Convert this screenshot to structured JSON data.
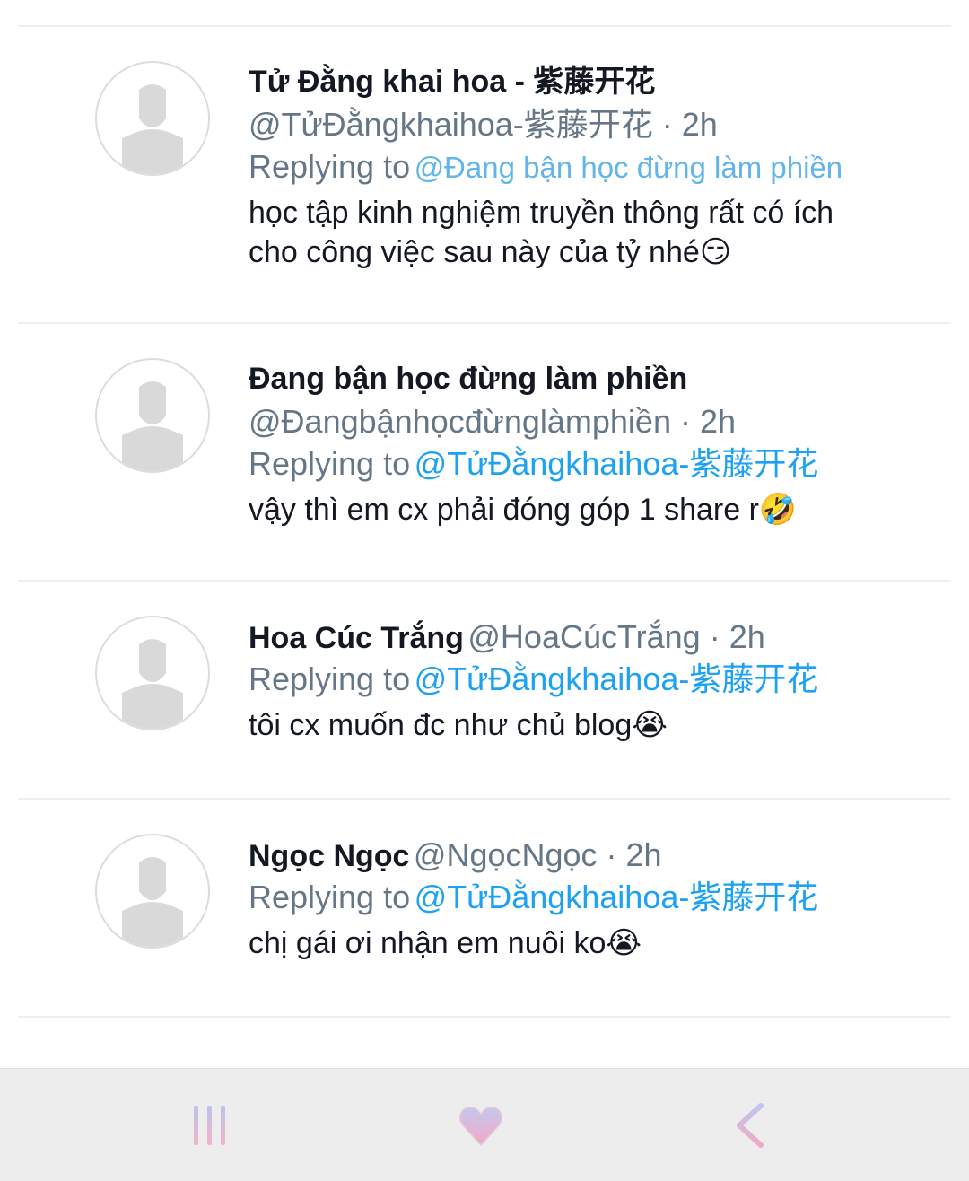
{
  "replies": [
    {
      "name": "Tử Đằng khai hoa - 紫藤开花",
      "handle": "@TửĐằngkhaihoa-紫藤开花 · 2h",
      "replying_label": "Replying to",
      "replying_to": "@Đang bận học đừng làm phiền",
      "text_lines": [
        "học tập kinh nghiệm truyền thông rất có ích",
        "cho công việc sau này của tỷ nhé😏"
      ]
    },
    {
      "name": "Đang bận học đừng làm phiền",
      "handle": "@Đangbậnhọcđừnglàmphiền · 2h",
      "replying_label": "Replying to",
      "replying_to": "@TửĐằngkhaihoa-紫藤开花",
      "text_lines": [
        "vậy thì em cx phải đóng góp 1 share r🤣"
      ]
    },
    {
      "name": "Hoa Cúc Trắng",
      "handle": "@HoaCúcTrắng · 2h",
      "replying_label": "Replying to",
      "replying_to": "@TửĐằngkhaihoa-紫藤开花",
      "text_lines": [
        "tôi cx muốn đc như chủ blog😭"
      ]
    },
    {
      "name": "Ngọc Ngọc",
      "handle": "@NgọcNgọc · 2h",
      "replying_label": "Replying to",
      "replying_to": "@TửĐằngkhaihoa-紫藤开花",
      "text_lines": [
        "chị gái ơi nhận em nuôi ko😭"
      ]
    }
  ],
  "navbar": {
    "recents_icon": "recent-apps-icon",
    "home_icon": "heart-home-icon",
    "back_icon": "back-chevron-icon"
  },
  "colors": {
    "name": "#141823",
    "handle": "#657786",
    "mention": "#1da1f2",
    "navbar_bg": "#ededed"
  }
}
